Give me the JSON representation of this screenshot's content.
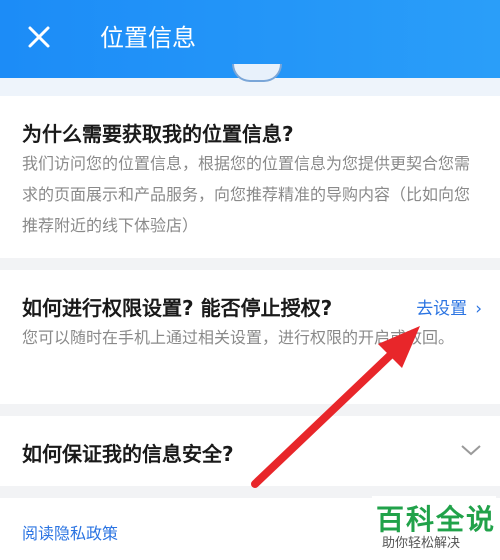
{
  "header": {
    "title": "位置信息",
    "close_icon": "close-icon",
    "bg": "#1c8cf7"
  },
  "sections": [
    {
      "heading": "为什么需要获取我的位置信息?",
      "body": "我们访问您的位置信息，根据您的位置信息为您提供更契合您需求的页面展示和产品服务，向您推荐精准的导购内容（比如向您推荐附近的线下体验店）"
    },
    {
      "heading": "如何进行权限设置? 能否停止授权?",
      "body": "您可以随时在手机上通过相关设置，进行权限的开启或收回。",
      "link": "去设置"
    },
    {
      "heading": "如何保证我的信息安全?"
    }
  ],
  "footer": {
    "privacy_link": "阅读隐私政策"
  },
  "watermark": {
    "title": "百科全说",
    "subtitle": "助你轻松解决"
  },
  "colors": {
    "link": "#2b74e2",
    "arrow": "#e8262a",
    "watermark": "#21a24a"
  }
}
